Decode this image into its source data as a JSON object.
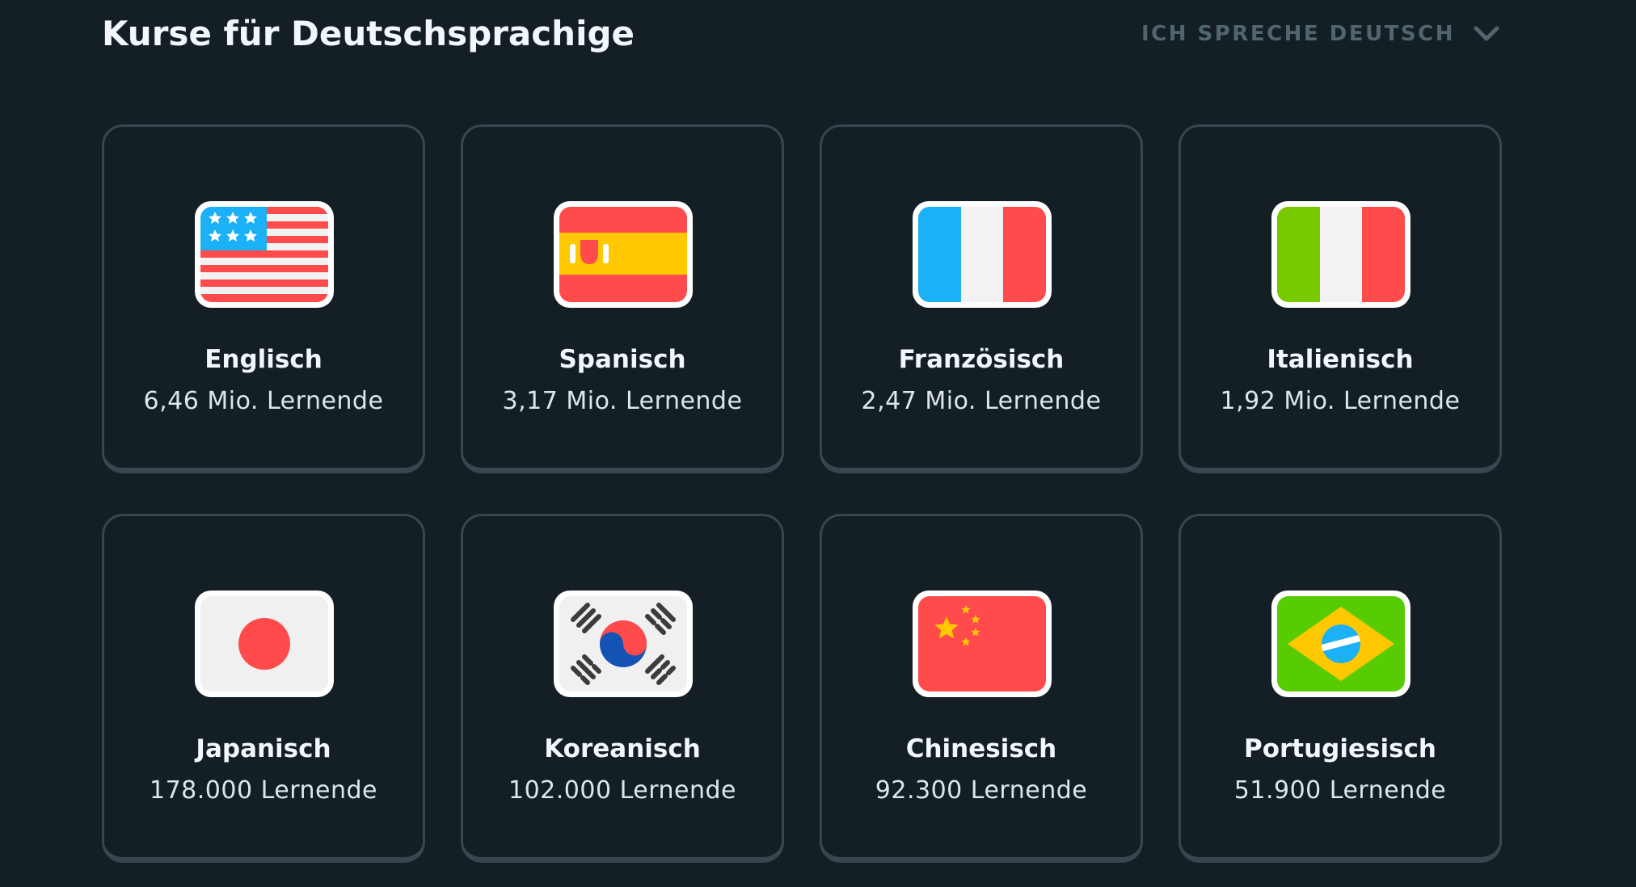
{
  "header": {
    "title": "Kurse für Deutschsprachige",
    "language_selector": {
      "label": "ICH SPRECHE DEUTSCH",
      "icon": "chevron-down-icon"
    }
  },
  "courses": [
    {
      "name": "Englisch",
      "learners": "6,46 Mio. Lernende",
      "flag": "us-flag-icon"
    },
    {
      "name": "Spanisch",
      "learners": "3,17 Mio. Lernende",
      "flag": "spain-flag-icon"
    },
    {
      "name": "Französisch",
      "learners": "2,47 Mio. Lernende",
      "flag": "france-flag-icon"
    },
    {
      "name": "Italienisch",
      "learners": "1,92 Mio. Lernende",
      "flag": "italy-flag-icon"
    },
    {
      "name": "Japanisch",
      "learners": "178.000 Lernende",
      "flag": "japan-flag-icon"
    },
    {
      "name": "Koreanisch",
      "learners": "102.000 Lernende",
      "flag": "korea-flag-icon"
    },
    {
      "name": "Chinesisch",
      "learners": "92.300 Lernende",
      "flag": "china-flag-icon"
    },
    {
      "name": "Portugiesisch",
      "learners": "51.900 Lernende",
      "flag": "brazil-flag-icon"
    }
  ],
  "colors": {
    "background": "#131f24",
    "card_border": "#37464f",
    "text_primary": "#f1f7fb",
    "text_muted": "#52656d"
  }
}
